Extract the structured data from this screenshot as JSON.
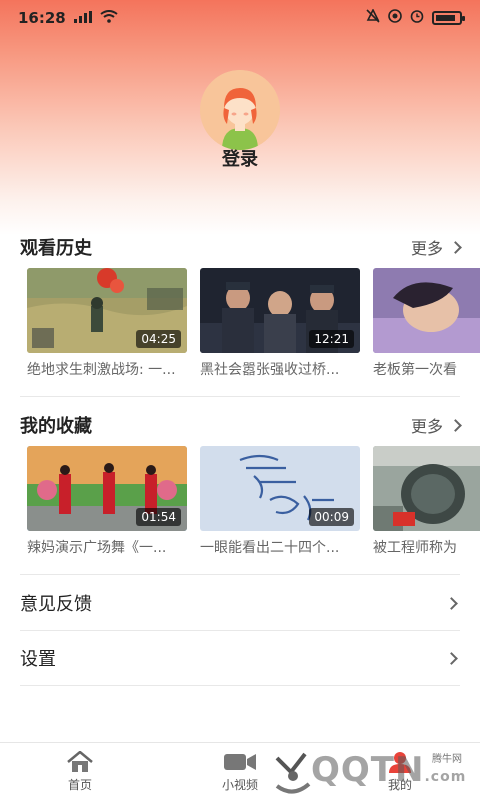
{
  "status_bar": {
    "time": "16:28",
    "icons": [
      "signal-icon",
      "wifi-icon",
      "alarm-muted-icon",
      "record-icon",
      "clock-icon",
      "battery-icon"
    ],
    "battery_level": 0.85
  },
  "profile": {
    "login_label": "登录",
    "avatar_icon": "user-avatar-icon"
  },
  "history": {
    "title": "观看历史",
    "more_label": "更多",
    "items": [
      {
        "title": "绝地求生刺激战场: 一...",
        "duration": "04:25",
        "thumb_color": "#a9a06b"
      },
      {
        "title": "黑社会嚣张强收过桥...",
        "duration": "12:21",
        "thumb_color": "#2b2f3a"
      },
      {
        "title": "老板第一次看",
        "duration": "",
        "thumb_color": "#9a86b8"
      }
    ]
  },
  "favorites": {
    "title": "我的收藏",
    "more_label": "更多",
    "items": [
      {
        "title": "辣妈演示广场舞《一...",
        "duration": "01:54",
        "thumb_color": "#d9b06a"
      },
      {
        "title": "一眼能看出二十四个...",
        "duration": "00:09",
        "thumb_color": "#cfd9ea"
      },
      {
        "title": "被工程师称为",
        "duration": "",
        "thumb_color": "#5d6b63"
      }
    ]
  },
  "menu": {
    "feedback_label": "意见反馈",
    "settings_label": "设置"
  },
  "bottom_nav": {
    "home_label": "首页",
    "short_video_label": "小视频",
    "mine_label": "我的"
  },
  "watermark": {
    "text": "QQTN",
    "small_text": "腾牛网",
    "suffix": ".com"
  },
  "colors": {
    "header_top": "#f4745c",
    "accent": "#e8433a"
  }
}
